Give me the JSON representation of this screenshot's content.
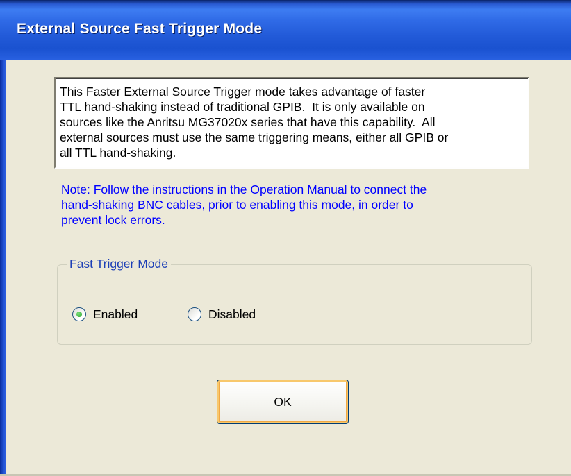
{
  "window": {
    "title": "External Source Fast Trigger Mode"
  },
  "description": "This Faster External Source Trigger mode takes advantage of faster\nTTL hand-shaking instead of traditional GPIB.  It is only available on\nsources like the Anritsu MG37020x series that have this capability.  All\nexternal sources must use the same triggering means, either all GPIB or\nall TTL hand-shaking.",
  "note": "Note: Follow the instructions in the Operation Manual to connect the\nhand-shaking BNC cables, prior to enabling this mode, in order to\nprevent lock errors.",
  "fast_trigger_group": {
    "legend": "Fast Trigger Mode",
    "options": [
      {
        "label": "Enabled",
        "selected": true
      },
      {
        "label": "Disabled",
        "selected": false
      }
    ]
  },
  "buttons": {
    "ok_label": "OK"
  },
  "colors": {
    "titlebar": "#2f6ae6",
    "note_text": "#0000ff",
    "group_legend": "#1c3fb6",
    "dialog_bg": "#ece9d8"
  }
}
